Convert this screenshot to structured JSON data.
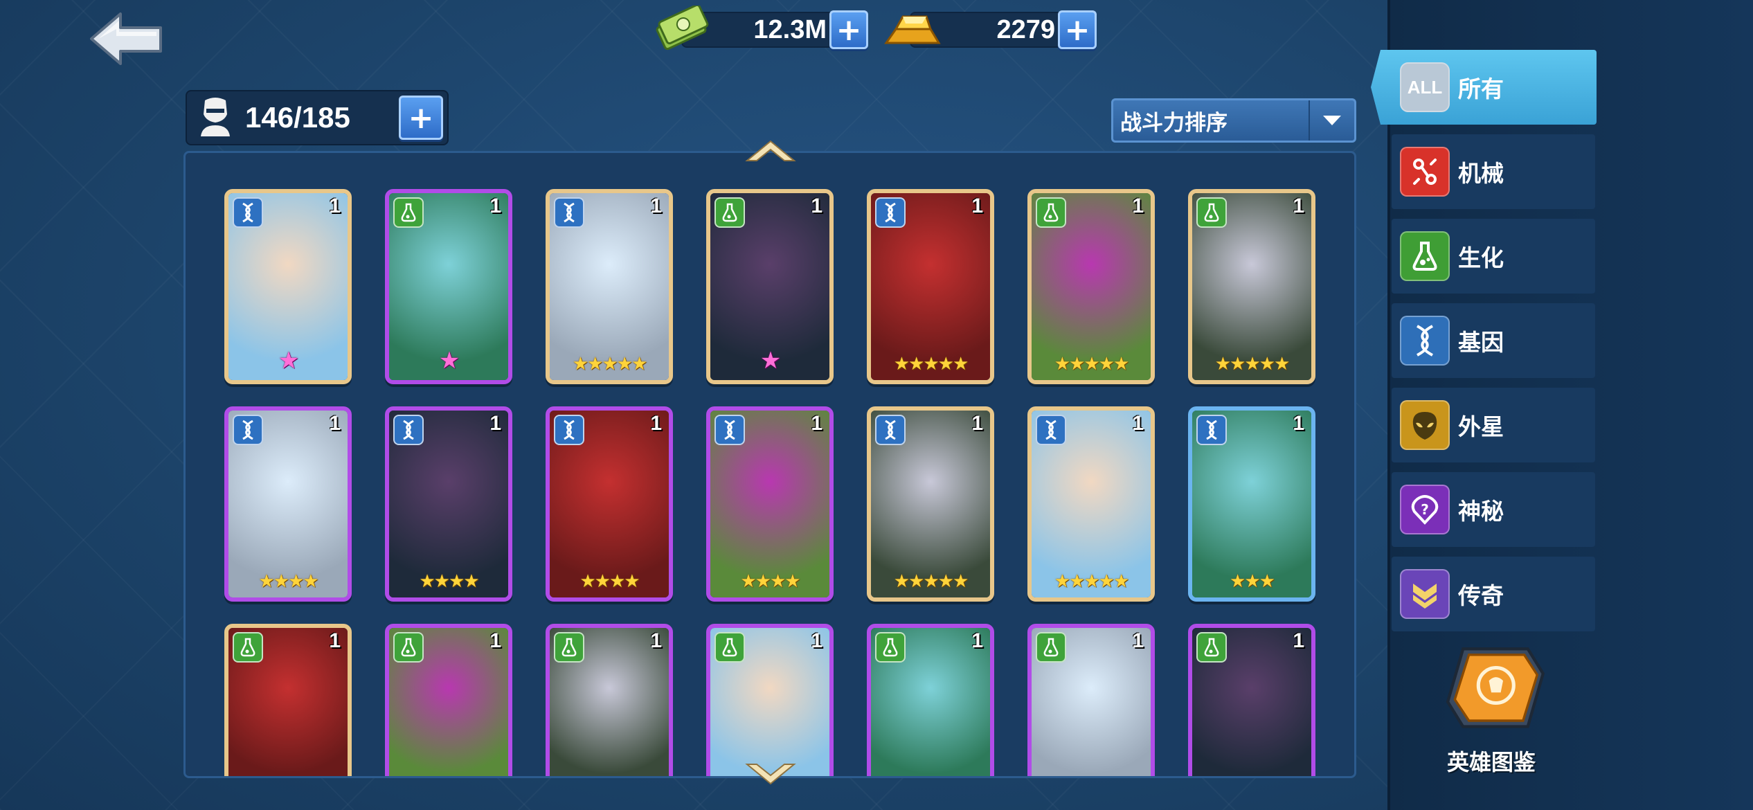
{
  "currency": {
    "cash": "12.3M",
    "gold": "2279"
  },
  "capacity": "146/185",
  "sort": {
    "label": "战斗力排序"
  },
  "filters": [
    {
      "label": "所有",
      "icon": "all-icon",
      "badge": "ALL",
      "active": true
    },
    {
      "label": "机械",
      "icon": "mech-icon"
    },
    {
      "label": "生化",
      "icon": "bio-icon"
    },
    {
      "label": "基因",
      "icon": "gene-icon"
    },
    {
      "label": "外星",
      "icon": "alien-icon"
    },
    {
      "label": "神秘",
      "icon": "mystic-icon"
    },
    {
      "label": "传奇",
      "icon": "legend-icon"
    }
  ],
  "codex_label": "英雄图鉴",
  "heroes": [
    [
      {
        "level": "1",
        "faction": "gene",
        "frame": "gold",
        "stars": "★",
        "star_type": "pink"
      },
      {
        "level": "1",
        "faction": "bio",
        "frame": "purple",
        "stars": "★",
        "star_type": "pink"
      },
      {
        "level": "1",
        "faction": "gene",
        "frame": "gold",
        "stars": "★★★★★",
        "star_type": "gold"
      },
      {
        "level": "1",
        "faction": "bio",
        "frame": "gold",
        "stars": "★",
        "star_type": "pink"
      },
      {
        "level": "1",
        "faction": "gene",
        "frame": "gold",
        "stars": "★★★★★",
        "star_type": "gold"
      },
      {
        "level": "1",
        "faction": "bio",
        "frame": "gold",
        "stars": "★★★★★",
        "star_type": "gold"
      },
      {
        "level": "1",
        "faction": "bio",
        "frame": "gold",
        "stars": "★★★★★",
        "star_type": "gold"
      }
    ],
    [
      {
        "level": "1",
        "faction": "gene",
        "frame": "purple",
        "stars": "★★★★",
        "star_type": "gold"
      },
      {
        "level": "1",
        "faction": "gene",
        "frame": "purple",
        "stars": "★★★★",
        "star_type": "gold"
      },
      {
        "level": "1",
        "faction": "gene",
        "frame": "purple",
        "stars": "★★★★",
        "star_type": "gold"
      },
      {
        "level": "1",
        "faction": "gene",
        "frame": "purple",
        "stars": "★★★★",
        "star_type": "gold"
      },
      {
        "level": "1",
        "faction": "gene",
        "frame": "gold",
        "stars": "★★★★★",
        "star_type": "gold"
      },
      {
        "level": "1",
        "faction": "gene",
        "frame": "gold",
        "stars": "★★★★★",
        "star_type": "gold"
      },
      {
        "level": "1",
        "faction": "gene",
        "frame": "blue",
        "stars": "★★★",
        "star_type": "gold"
      }
    ],
    [
      {
        "level": "1",
        "faction": "bio",
        "frame": "gold",
        "stars": "",
        "star_type": "gold"
      },
      {
        "level": "1",
        "faction": "bio",
        "frame": "purple",
        "stars": "",
        "star_type": "gold"
      },
      {
        "level": "1",
        "faction": "bio",
        "frame": "purple",
        "stars": "",
        "star_type": "gold"
      },
      {
        "level": "1",
        "faction": "bio",
        "frame": "purple",
        "stars": "",
        "star_type": "gold"
      },
      {
        "level": "1",
        "faction": "bio",
        "frame": "purple",
        "stars": "",
        "star_type": "gold"
      },
      {
        "level": "1",
        "faction": "bio",
        "frame": "purple",
        "stars": "",
        "star_type": "gold"
      },
      {
        "level": "1",
        "faction": "bio",
        "frame": "purple",
        "stars": "",
        "star_type": "gold"
      }
    ]
  ],
  "colors": {
    "frame_gold": "#e8c78a",
    "frame_purple": "#b14ce8",
    "frame_blue": "#6bb4f0",
    "active_filter": "#4fb8e6",
    "plus_button": "#3f86de"
  }
}
